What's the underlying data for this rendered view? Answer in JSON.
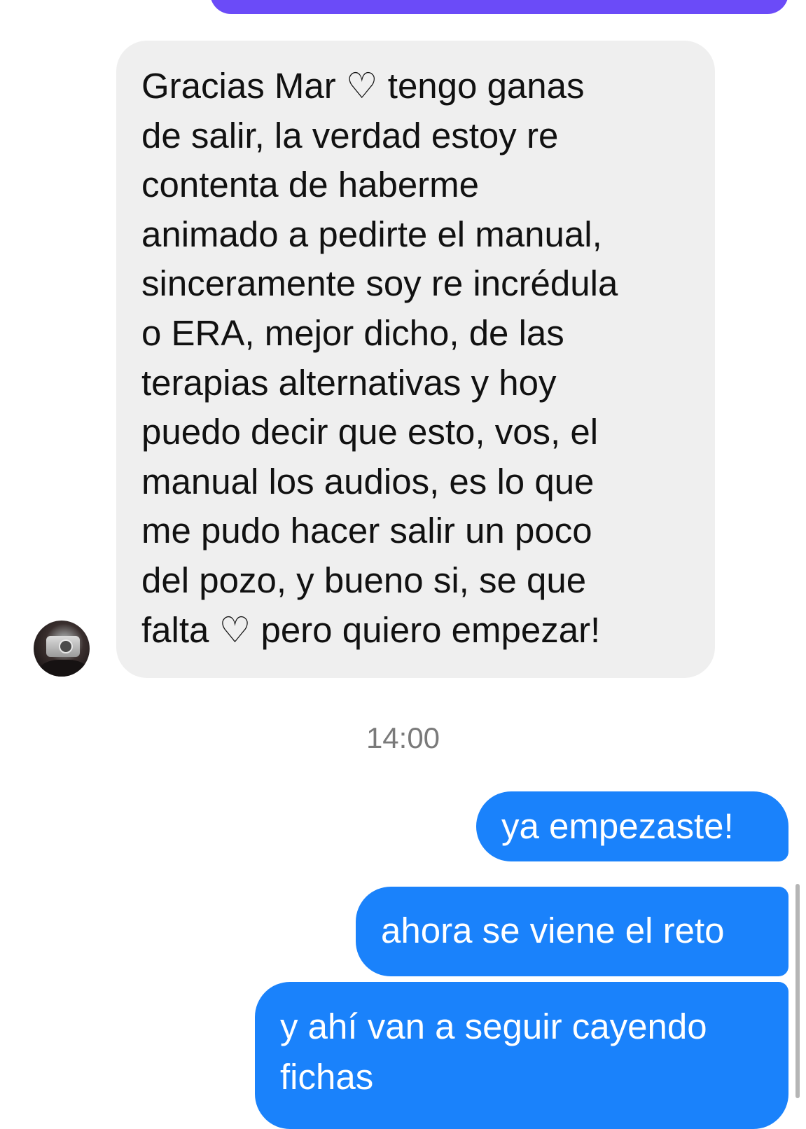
{
  "conversation": {
    "incoming_message": "Gracias Mar ♡ tengo ganas\nde salir, la verdad estoy re\ncontenta de haberme\nanimado a pedirte el manual,\nsinceramente soy re incrédula\no ERA, mejor dicho, de las\nterapias alternativas y hoy\npuedo decir que esto, vos, el\nmanual  los audios, es lo que\nme pudo hacer salir un poco\ndel pozo, y bueno si, se que\nfalta ♡ pero quiero empezar!",
    "timestamp": "14:00",
    "outgoing_messages": [
      {
        "text": "ya empezaste!"
      },
      {
        "text": "ahora se viene el reto"
      },
      {
        "text": "y ahí van a seguir cayendo\nfichas"
      }
    ]
  },
  "colors": {
    "outgoing_bubble": "#1a82fb",
    "incoming_bubble": "#efefef",
    "previous_bubble": "#6b4bf8",
    "timestamp_text": "#7a7a7a"
  }
}
